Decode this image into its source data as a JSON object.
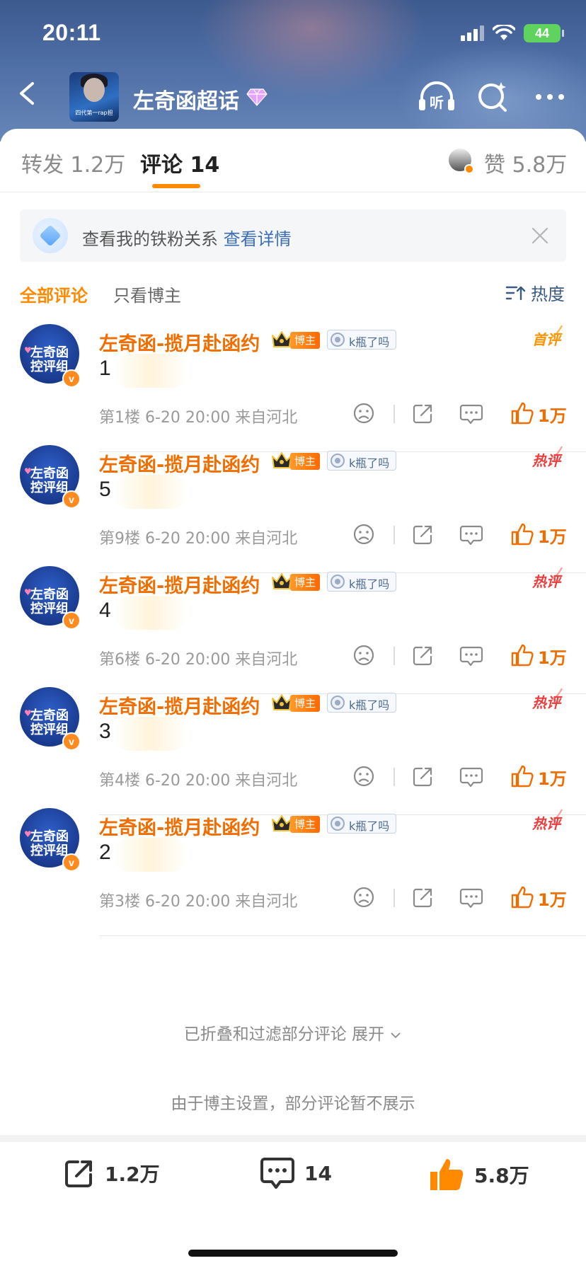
{
  "status_bar": {
    "time": "20:11",
    "battery": "44"
  },
  "header": {
    "topic_title": "左奇函超话",
    "topic_avatar_caption": "四代第一rap担",
    "topic_avatar_name": "左奇函"
  },
  "tabs": [
    {
      "label": "转发 1.2万"
    },
    {
      "label": "评论 14"
    },
    {
      "label": "赞 5.8万"
    }
  ],
  "fan_banner": {
    "text": "查看我的铁粉关系",
    "link": "查看详情"
  },
  "filters": {
    "all": "全部评论",
    "blogger_only": "只看博主",
    "sort": "热度"
  },
  "comments": [
    {
      "name": "左奇函-揽月赴函约",
      "badge": "博主",
      "k_badge": "k瓶了吗",
      "tag": "首评",
      "text": "1",
      "meta": "第1楼 6-20 20:00 来自河北",
      "likes": "1万"
    },
    {
      "name": "左奇函-揽月赴函约",
      "badge": "博主",
      "k_badge": "k瓶了吗",
      "tag": "热评",
      "text": "5",
      "meta": "第9楼 6-20 20:00 来自河北",
      "likes": "1万"
    },
    {
      "name": "左奇函-揽月赴函约",
      "badge": "博主",
      "k_badge": "k瓶了吗",
      "tag": "热评",
      "text": "4",
      "meta": "第6楼 6-20 20:00 来自河北",
      "likes": "1万"
    },
    {
      "name": "左奇函-揽月赴函约",
      "badge": "博主",
      "k_badge": "k瓶了吗",
      "tag": "热评",
      "text": "3",
      "meta": "第4楼 6-20 20:00 来自河北",
      "likes": "1万"
    },
    {
      "name": "左奇函-揽月赴函约",
      "badge": "博主",
      "k_badge": "k瓶了吗",
      "tag": "热评",
      "text": "2",
      "meta": "第3楼 6-20 20:00 来自河北",
      "likes": "1万"
    }
  ],
  "avatar_text": {
    "line1": "左奇函",
    "line2": "控评组",
    "verified": "v"
  },
  "folded": {
    "text": "已折叠和过滤部分评论",
    "expand": "展开"
  },
  "blogger_note": "由于博主设置，部分评论暂不展示",
  "bottom_bar": {
    "reposts": "1.2万",
    "comments": "14",
    "likes": "5.8万"
  },
  "colors": {
    "accent": "#ff8a00",
    "name_orange": "#f06d00",
    "hot_red": "#ef3b3b",
    "link_blue": "#3a6db3"
  }
}
